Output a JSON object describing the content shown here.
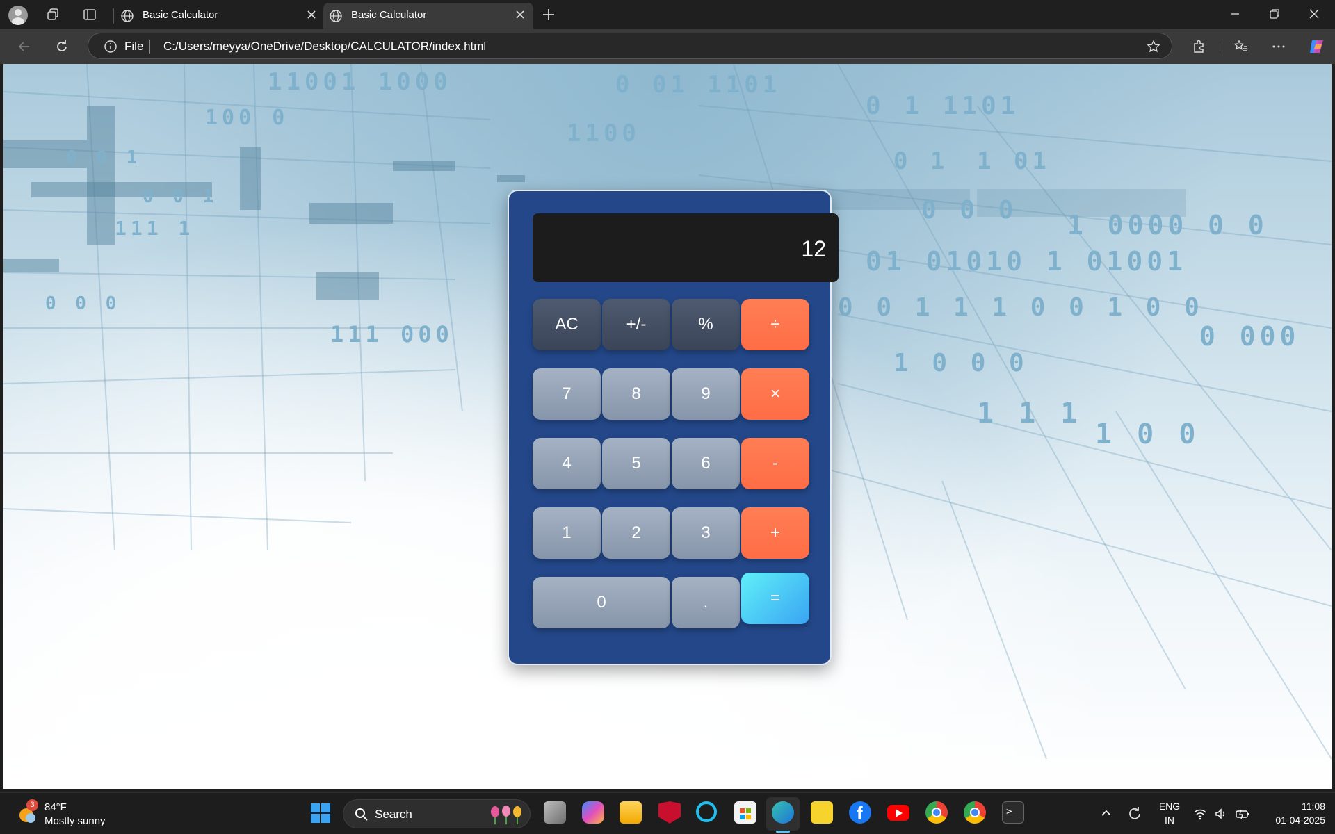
{
  "browser": {
    "tabs": [
      {
        "title": "Basic Calculator",
        "active": false
      },
      {
        "title": "Basic Calculator",
        "active": true
      }
    ],
    "address": {
      "scheme_label": "File",
      "url": "C:/Users/meyya/OneDrive/Desktop/CALCULATOR/index.html"
    }
  },
  "calculator": {
    "display": "12",
    "rows": [
      [
        {
          "label": "AC",
          "kind": "func"
        },
        {
          "label": "+/-",
          "kind": "func"
        },
        {
          "label": "%",
          "kind": "func"
        },
        {
          "label": "÷",
          "kind": "op"
        }
      ],
      [
        {
          "label": "7",
          "kind": "num"
        },
        {
          "label": "8",
          "kind": "num"
        },
        {
          "label": "9",
          "kind": "num"
        },
        {
          "label": "×",
          "kind": "op"
        }
      ],
      [
        {
          "label": "4",
          "kind": "num"
        },
        {
          "label": "5",
          "kind": "num"
        },
        {
          "label": "6",
          "kind": "num"
        },
        {
          "label": "-",
          "kind": "op"
        }
      ],
      [
        {
          "label": "1",
          "kind": "num"
        },
        {
          "label": "2",
          "kind": "num"
        },
        {
          "label": "3",
          "kind": "num"
        },
        {
          "label": "+",
          "kind": "op"
        }
      ],
      [
        {
          "label": "0",
          "kind": "num"
        },
        {
          "label": ".",
          "kind": "num"
        },
        {
          "label": "=",
          "kind": "eq"
        }
      ]
    ],
    "colors": {
      "body": "#234788",
      "operator": "#ff6d45",
      "equals": "#3ad2f5",
      "display": "#1c1c1c"
    }
  },
  "background": {
    "binary_strings": [
      "11001 1000",
      "100 0",
      "0 0 1",
      "1100",
      "0 01 1101",
      "0 1 1101",
      "1 01",
      "0 1",
      "0 0 0",
      "1 0000 0 0",
      "01 01010 1 01001",
      "0 0 1 1 1 0 0 1 0 0",
      "0 000",
      "1 0 0 0",
      "1 1 1",
      "1 0 0",
      "111 1",
      "111 000",
      "0 0 0",
      "0 0 1"
    ]
  },
  "taskbar": {
    "weather": {
      "temp": "84°F",
      "condition": "Mostly sunny",
      "badge": "3"
    },
    "search_label": "Search",
    "lang": {
      "line1": "ENG",
      "line2": "IN"
    },
    "clock": {
      "time": "11:08",
      "date": "01-04-2025"
    },
    "pinned": [
      "widgets-icon",
      "task-view-icon",
      "copilot-icon",
      "file-explorer-icon",
      "mcafee-icon",
      "cortana-icon",
      "microsoft-store-icon",
      "edge-icon",
      "sticky-notes-icon",
      "facebook-icon",
      "youtube-icon",
      "chrome-icon",
      "chrome-profile-icon",
      "terminal-icon"
    ]
  }
}
